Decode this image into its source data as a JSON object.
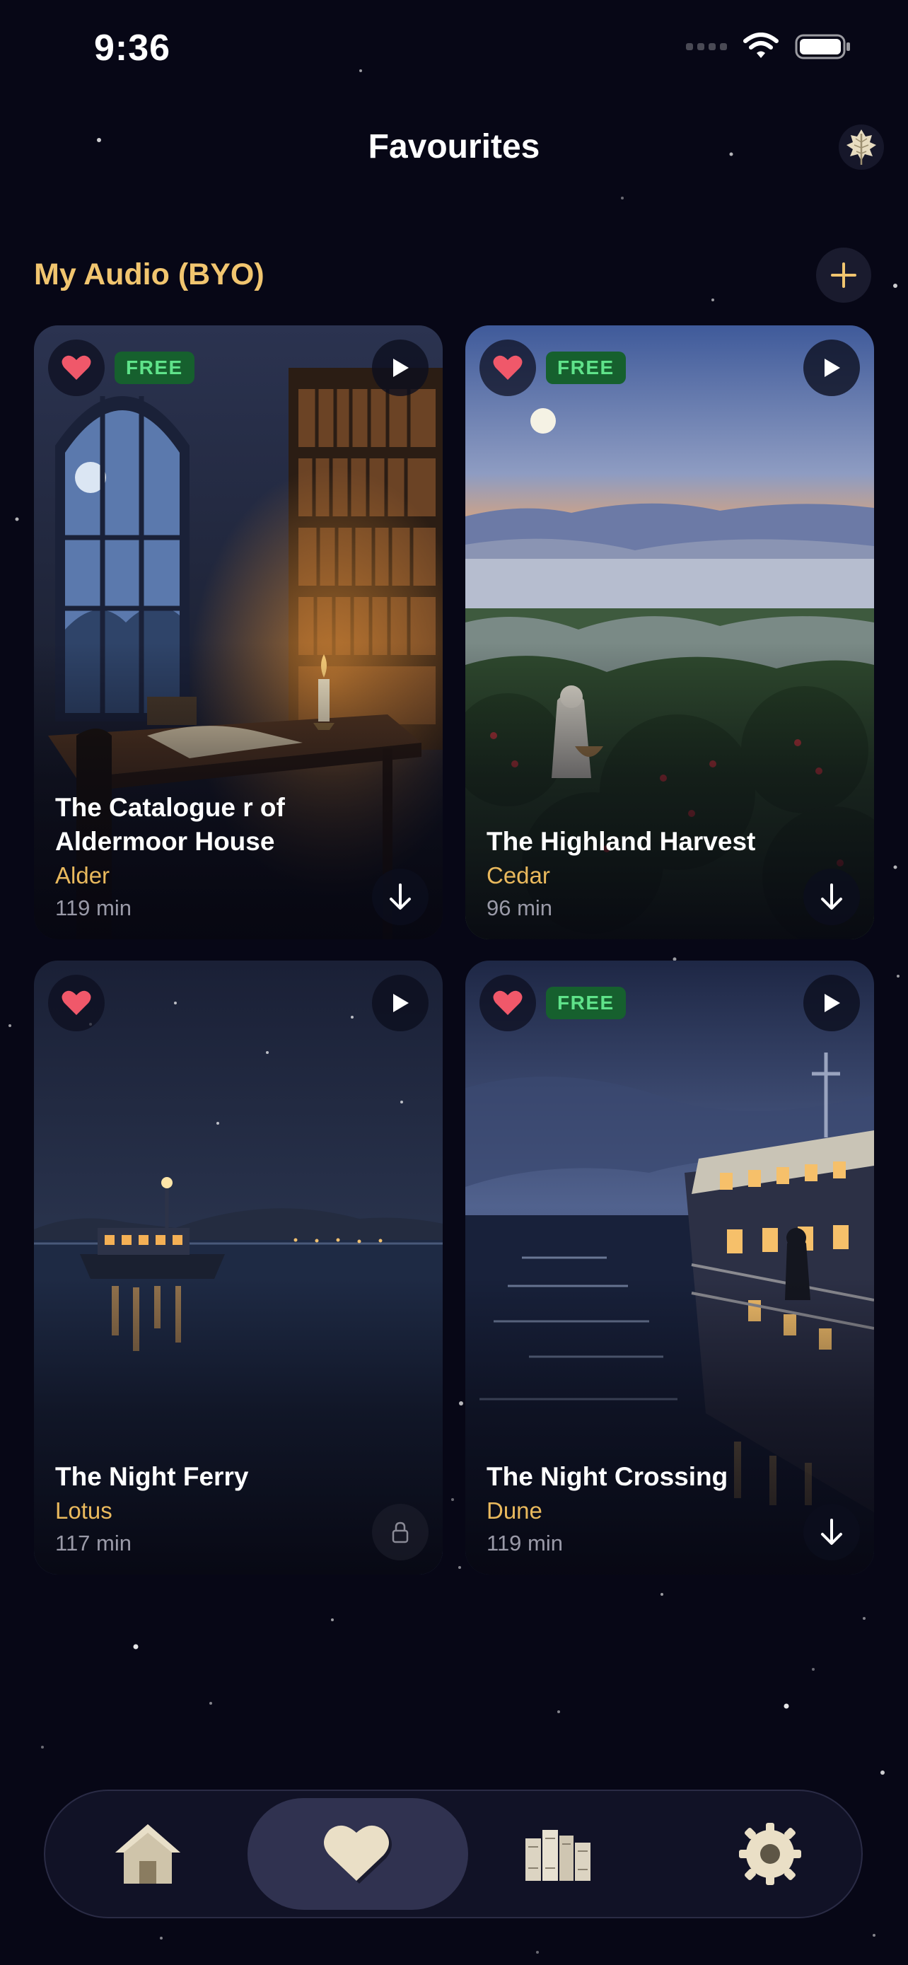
{
  "status_bar": {
    "time": "9:36"
  },
  "header": {
    "title": "Favourites",
    "leaf_icon": "leaf-icon"
  },
  "section": {
    "title": "My Audio (BYO)",
    "add_icon": "plus-icon"
  },
  "cards": [
    {
      "title_lines": [
        "The Catalogue r of",
        "Aldermoor House"
      ],
      "narrator": "Alder",
      "duration": "119 min",
      "free": true,
      "free_label": "FREE",
      "action": "download",
      "scene": "library"
    },
    {
      "title_lines": [
        "The Highland Harvest"
      ],
      "narrator": "Cedar",
      "duration": "96 min",
      "free": true,
      "free_label": "FREE",
      "action": "download",
      "scene": "highland"
    },
    {
      "title_lines": [
        "The Night Ferry"
      ],
      "narrator": "Lotus",
      "duration": "117 min",
      "free": false,
      "action": "locked",
      "scene": "ferry"
    },
    {
      "title_lines": [
        "The Night Crossing"
      ],
      "narrator": "Dune",
      "duration": "119 min",
      "free": true,
      "free_label": "FREE",
      "action": "download",
      "scene": "crossing"
    }
  ],
  "tab_bar": {
    "tabs": [
      {
        "name": "home",
        "icon": "home-icon",
        "active": false
      },
      {
        "name": "favourites",
        "icon": "heart-icon",
        "active": true
      },
      {
        "name": "library",
        "icon": "library-icon",
        "active": false
      },
      {
        "name": "settings",
        "icon": "settings-icon",
        "active": false
      }
    ]
  },
  "colors": {
    "background": "#070716",
    "accent": "#f1c56f",
    "narrator": "#e9b95d",
    "heart": "#f0586a",
    "free_bg": "#16602e",
    "free_text": "#5fe38a"
  }
}
